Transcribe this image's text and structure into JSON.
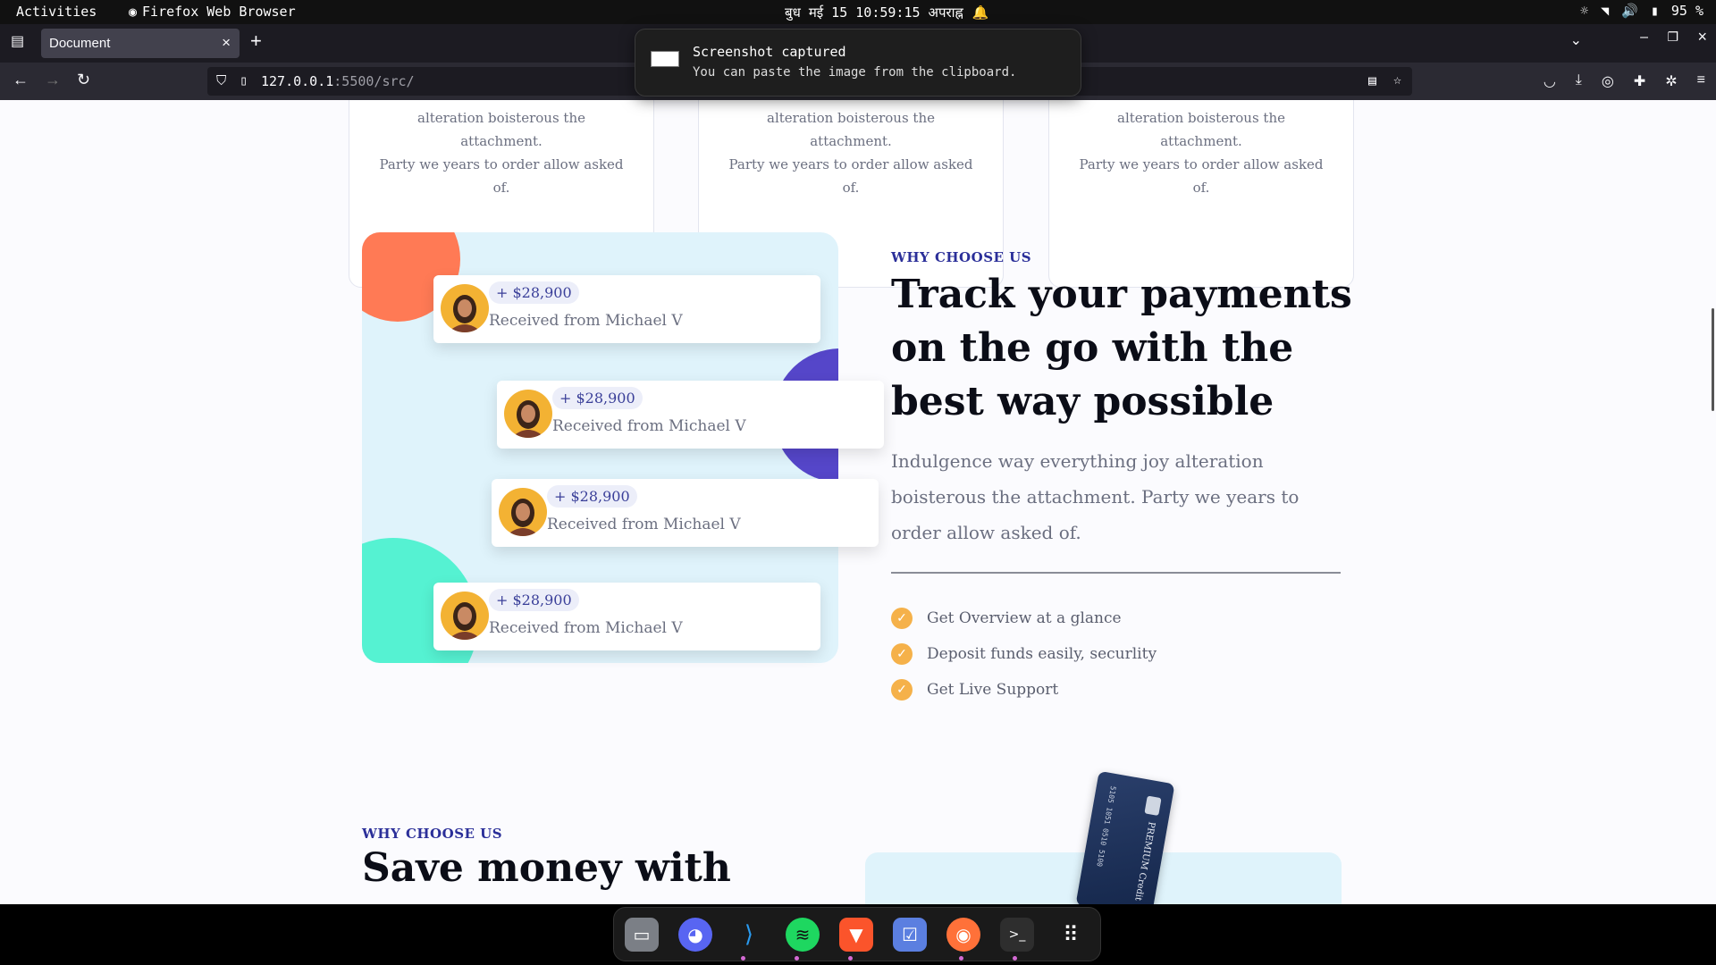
{
  "topbar": {
    "activities": "Activities",
    "app": "Firefox Web Browser",
    "clock": "बुध मई 15  10:59:15 अपराह्न",
    "battery": "95 %"
  },
  "tab": {
    "title": "Document",
    "close": "×",
    "new_tab": "+"
  },
  "url": {
    "host": "127.0.0.1",
    "path": ":5500/src/"
  },
  "toast": {
    "title": "Screenshot captured",
    "body": "You can paste the image from the clipboard."
  },
  "feature_cards": [
    {
      "text_line1": "alteration boisterous the attachment.",
      "text_line2": "Party we years to order allow asked",
      "text_line3": "of."
    },
    {
      "text_line1": "alteration boisterous the attachment.",
      "text_line2": "Party we years to order allow asked",
      "text_line3": "of."
    },
    {
      "text_line1": "alteration boisterous the attachment.",
      "text_line2": "Party we years to order allow asked",
      "text_line3": "of."
    }
  ],
  "payments": [
    {
      "amount": "+ $28,900",
      "label": "Received from Michael V"
    },
    {
      "amount": "+ $28,900",
      "label": "Received from Michael V"
    },
    {
      "amount": "+ $28,900",
      "label": "Received from Michael V"
    },
    {
      "amount": "+ $28,900",
      "label": "Received from Michael V"
    }
  ],
  "section1": {
    "kicker": "WHY CHOOSE US",
    "heading": "Track your payments on the go with the best way possible",
    "description": "Indulgence way everything joy alteration boisterous the attachment. Party we years to order allow asked of.",
    "features": [
      "Get Overview at a glance",
      "Deposit funds easily, securlity",
      "Get Live Support"
    ]
  },
  "section2": {
    "kicker": "WHY CHOOSE US",
    "heading": "Save money with",
    "card_label": "PREMIUM Credit",
    "card_number": "5105 1051 0510 5100"
  },
  "colors": {
    "accent_orange": "#ff7a55",
    "accent_purple": "#5546c9",
    "accent_teal": "#55f2d2",
    "check": "#f5b14a",
    "kicker": "#2b2f99"
  },
  "dock": [
    "files-icon",
    "discord-icon",
    "vscode-icon",
    "spotify-icon",
    "brave-icon",
    "tasks-icon",
    "firefox-icon",
    "terminal-icon",
    "app-grid-icon"
  ]
}
